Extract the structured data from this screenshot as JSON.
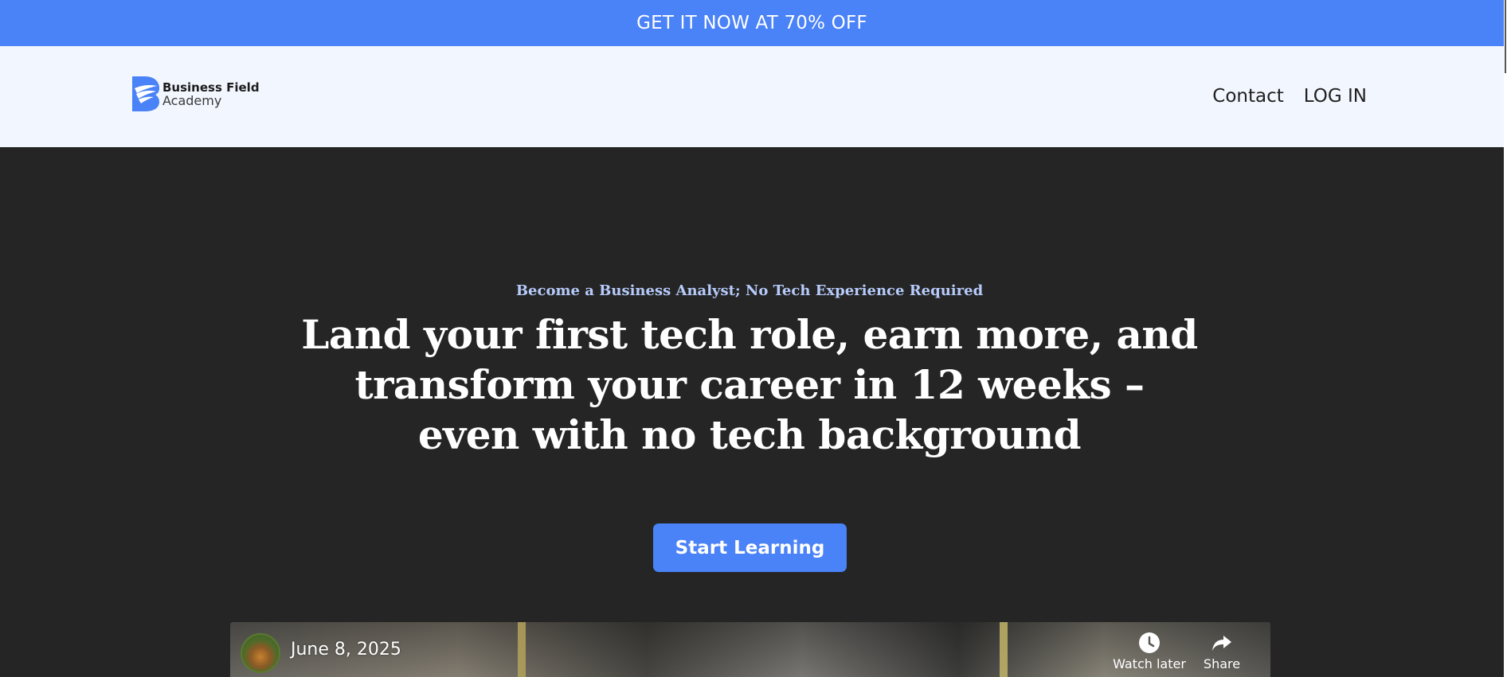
{
  "promo": {
    "text": "GET IT NOW AT 70% OFF"
  },
  "header": {
    "logo": {
      "line1": "Business Field",
      "line2": "Academy"
    },
    "nav": [
      {
        "label": "Contact"
      },
      {
        "label": "LOG IN"
      }
    ]
  },
  "hero": {
    "eyebrow": "Become a Business Analyst; No Tech Experience Required",
    "headline_lines": [
      "Land your first tech role, earn more, and",
      "transform your career in 12 weeks –",
      "even with no tech background"
    ],
    "cta_label": "Start Learning"
  },
  "video": {
    "date": "June 8, 2025",
    "actions": [
      {
        "label": "Watch later",
        "icon": "clock-icon"
      },
      {
        "label": "Share",
        "icon": "share-arrow-icon"
      }
    ]
  },
  "colors": {
    "accent": "#4a82f7",
    "hero_background": "#252525",
    "header_background": "#f2f6fe",
    "eyebrow": "#b7cbfb"
  }
}
